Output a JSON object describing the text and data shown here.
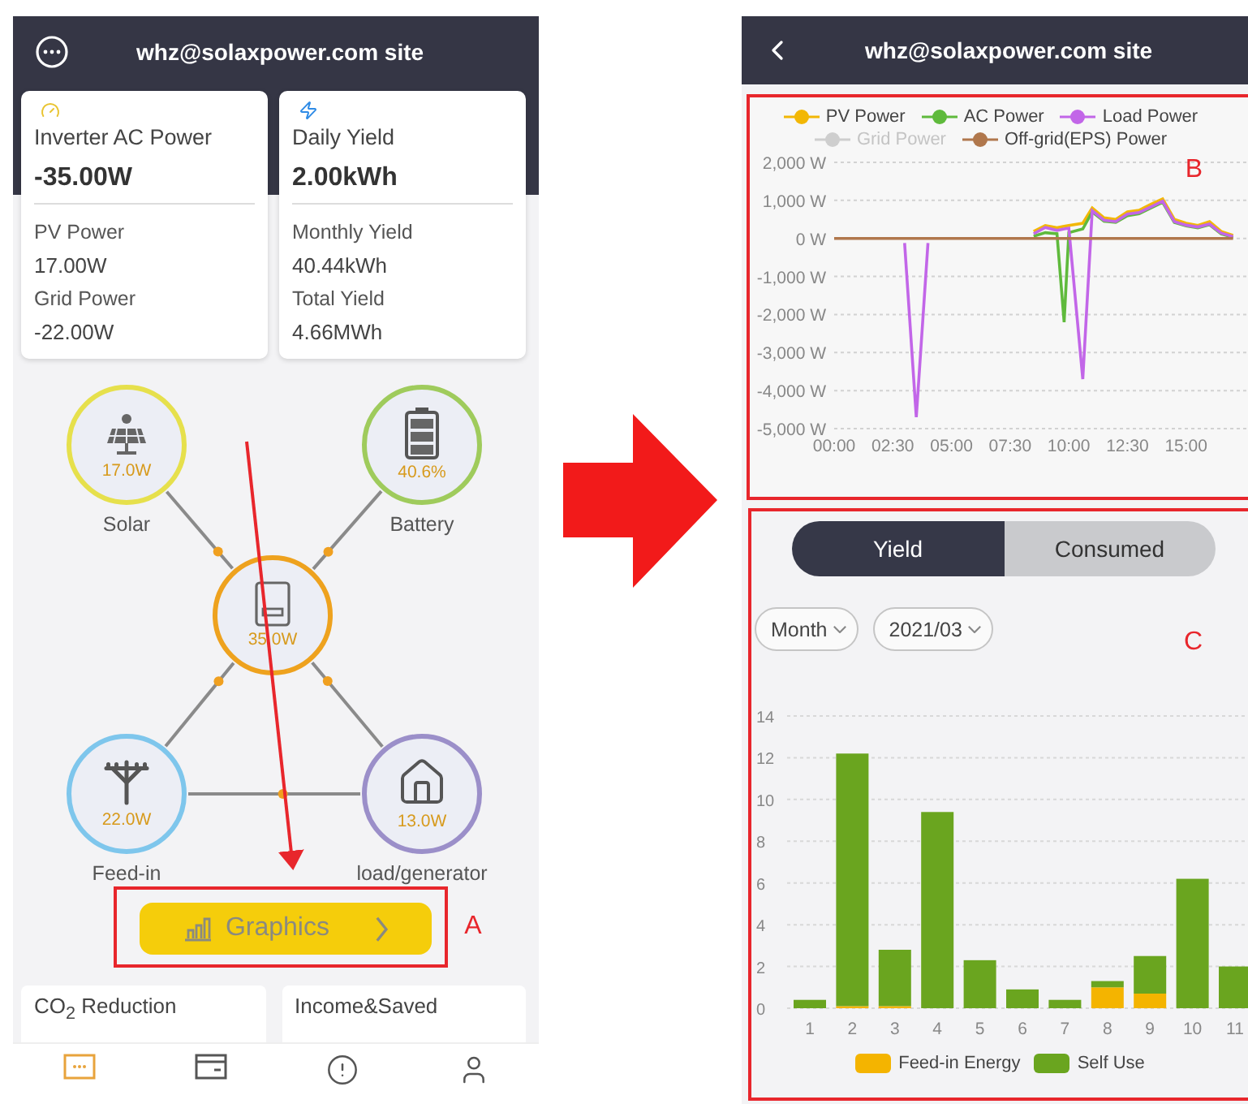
{
  "left_screen": {
    "title": "whz@solaxpower.com site",
    "cards": [
      {
        "kind": "gauge",
        "heading": "Inverter AC Power",
        "value": "-35.00W",
        "rows": [
          {
            "label": "PV Power",
            "value": "17.00W"
          },
          {
            "label": "Grid Power",
            "value": "-22.00W"
          }
        ]
      },
      {
        "kind": "bolt",
        "heading": "Daily Yield",
        "value": "2.00kWh",
        "rows": [
          {
            "label": "Monthly Yield",
            "value": "40.44kWh"
          },
          {
            "label": "Total Yield",
            "value": "4.66MWh"
          }
        ]
      }
    ],
    "flow_nodes": [
      {
        "kind": "solar",
        "reading": "17.0W",
        "label": "Solar",
        "color": "#e6e04c"
      },
      {
        "kind": "battery",
        "reading": "40.6%",
        "label": "Battery",
        "color": "#9fcb5c"
      },
      {
        "kind": "inverter",
        "reading": "35.0W",
        "color": "#eea21e"
      },
      {
        "kind": "grid",
        "reading": "22.0W",
        "label": "Feed-in",
        "color": "#7ec6ec"
      },
      {
        "kind": "home",
        "reading": "13.0W",
        "label": "load/generator",
        "color": "#9b8fc9"
      }
    ],
    "graphics_button": "Graphics",
    "summary_cards": [
      "CO$_{2}$ Reduction",
      "Income&Saved"
    ],
    "nav": [
      {
        "kind": "site",
        "selected": true
      },
      {
        "kind": "inverter",
        "selected": false
      },
      {
        "kind": "alarm",
        "selected": false
      },
      {
        "kind": "account",
        "selected": false
      }
    ]
  },
  "annotations": [
    {
      "label": "A"
    },
    {
      "label": "B"
    },
    {
      "label": "C"
    }
  ],
  "right_screen": {
    "title": "whz@solaxpower.com site",
    "power_chart": {
      "legend": [
        {
          "enabled": true
        },
        {
          "enabled": true
        },
        {
          "enabled": true
        },
        {
          "enabled": false
        },
        {
          "enabled": true
        }
      ],
      "chart_data": {
        "type": "line",
        "grid": true,
        "x": [
          0,
          1,
          2,
          3,
          3.5,
          4,
          5,
          6,
          7,
          7.5,
          8,
          8.5,
          9,
          9.5,
          9.8,
          10,
          10.6,
          11,
          11.5,
          12,
          12.5,
          13,
          13.5,
          14,
          14.5,
          15,
          15.5,
          16,
          16.5,
          17
        ],
        "series": [
          {
            "name": "PV Power",
            "color": "#f2b705",
            "values": [
              null,
              null,
              null,
              null,
              null,
              null,
              null,
              null,
              null,
              null,
              null,
              180,
              340,
              280,
              320,
              340,
              400,
              800,
              540,
              500,
              700,
              740,
              900,
              1040,
              500,
              400,
              340,
              440,
              180,
              80
            ]
          },
          {
            "name": "AC Power",
            "color": "#5fba3c",
            "values": [
              null,
              null,
              null,
              null,
              null,
              null,
              null,
              null,
              null,
              null,
              null,
              60,
              150,
              120,
              -2200,
              150,
              250,
              700,
              450,
              420,
              600,
              650,
              800,
              950,
              420,
              330,
              280,
              360,
              120,
              30
            ]
          },
          {
            "name": "Load Power",
            "color": "#c266e8",
            "values": [
              null,
              null,
              null,
              -120,
              -4700,
              -120,
              null,
              null,
              null,
              null,
              null,
              120,
              290,
              210,
              250,
              270,
              -3700,
              730,
              480,
              440,
              640,
              680,
              830,
              980,
              440,
              350,
              300,
              380,
              140,
              50
            ]
          },
          {
            "name": "Grid Power",
            "color": "#c8c8c8",
            "values": [
              null,
              null,
              null,
              null,
              null,
              null,
              null,
              null,
              null,
              null,
              null,
              null,
              null,
              null,
              null,
              null,
              null,
              null,
              null,
              null,
              null,
              null,
              null,
              null,
              null,
              null,
              null,
              null,
              null,
              null
            ]
          },
          {
            "name": "Off-grid(EPS) Power",
            "color": "#b0774c",
            "values": [
              0,
              0,
              0,
              0,
              0,
              0,
              0,
              0,
              0,
              0,
              0,
              0,
              0,
              0,
              0,
              0,
              0,
              0,
              0,
              0,
              0,
              0,
              0,
              0,
              0,
              0,
              0,
              0,
              0,
              0
            ]
          }
        ],
        "xlim": [
          0,
          17.5
        ],
        "ylim": [
          -5000,
          2000
        ],
        "yticks": [
          {
            "value": 2000,
            "label": "2,000 W"
          },
          {
            "value": 1000,
            "label": "1,000 W"
          },
          {
            "value": 0,
            "label": "0 W"
          },
          {
            "value": -1000,
            "label": "-1,000 W"
          },
          {
            "value": -2000,
            "label": "-2,000 W"
          },
          {
            "value": -3000,
            "label": "-3,000 W"
          },
          {
            "value": -4000,
            "label": "-4,000 W"
          },
          {
            "value": -5000,
            "label": "-5,000 W"
          }
        ],
        "xticks": [
          {
            "value": 0,
            "label": "00:00"
          },
          {
            "value": 2.5,
            "label": "02:30"
          },
          {
            "value": 5,
            "label": "05:00"
          },
          {
            "value": 7.5,
            "label": "07:30"
          },
          {
            "value": 10,
            "label": "10:00"
          },
          {
            "value": 12.5,
            "label": "12:30"
          },
          {
            "value": 15,
            "label": "15:00"
          }
        ]
      }
    },
    "tabs": [
      {
        "label": "Yield",
        "selected": true
      },
      {
        "label": "Consumed",
        "selected": false
      }
    ],
    "filters": [
      {
        "value": "Month"
      },
      {
        "value": "2021/03"
      }
    ],
    "energy_chart": {
      "chart_data": {
        "type": "bar",
        "stacked": true,
        "grid": true,
        "categories": [
          "1",
          "2",
          "3",
          "4",
          "5",
          "6",
          "7",
          "8",
          "9",
          "10",
          "11"
        ],
        "series": [
          {
            "name": "Feed-in Energy",
            "color": "#f4b400",
            "values": [
              0,
              0.1,
              0.1,
              0,
              0,
              0,
              0,
              1.0,
              0.7,
              0,
              0
            ]
          },
          {
            "name": "Self Use",
            "color": "#6aa51f",
            "values": [
              0.4,
              12.1,
              2.7,
              9.4,
              2.3,
              0.9,
              0.4,
              0.3,
              1.8,
              6.2,
              2.0
            ]
          }
        ],
        "ylim": [
          0,
          14
        ],
        "yticks": [
          0,
          2,
          4,
          6,
          8,
          10,
          12,
          14
        ]
      }
    }
  }
}
